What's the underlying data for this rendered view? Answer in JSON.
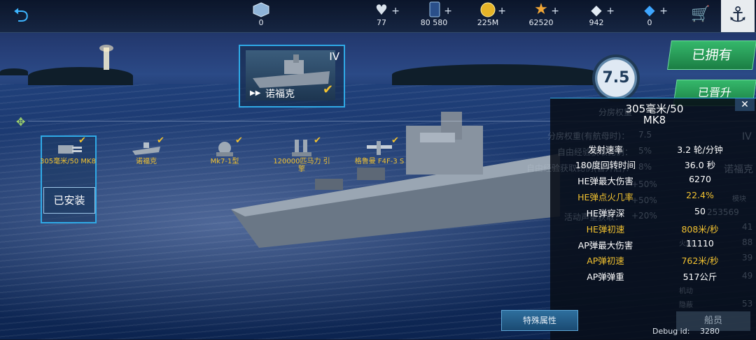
{
  "topbar": {
    "resources": [
      {
        "name": "rank",
        "value": "0",
        "icon": "rank-badge-icon"
      },
      {
        "name": "hearts",
        "value": "77",
        "icon": "heart-icon"
      },
      {
        "name": "cards",
        "value": "80 580",
        "icon": "card-icon"
      },
      {
        "name": "gold",
        "value": "225M",
        "icon": "gold-coin-icon"
      },
      {
        "name": "stars",
        "value": "62520",
        "icon": "star-icon"
      },
      {
        "name": "diamonds",
        "value": "942",
        "icon": "diamond-icon"
      },
      {
        "name": "blue_gems",
        "value": "0",
        "icon": "blue-gem-icon"
      }
    ],
    "plus": "+"
  },
  "ship_card": {
    "tier": "IV",
    "name": "诺福克"
  },
  "rating": "7.5",
  "buttons": {
    "owned": "已拥有",
    "upgraded": "已晋升",
    "installed": "已安装",
    "special": "特殊属性",
    "crew": "船员"
  },
  "modules": [
    {
      "label": "305毫米/50 MK8"
    },
    {
      "label": "诺福克"
    },
    {
      "label": "Mk7-1型"
    },
    {
      "label": "120000匹马力 引擎"
    },
    {
      "label": "格鲁曼 F4F-3 S"
    }
  ],
  "panel": {
    "title": "305毫米/50 MK8",
    "close": "✕",
    "stats": [
      {
        "k": "发射速率",
        "v": "3.2 轮/分钟",
        "hl": false
      },
      {
        "k": "180度回转时间",
        "v": "36.0 秒",
        "hl": false
      },
      {
        "k": "HE弹最大伤害",
        "v": "6270",
        "hl": false
      },
      {
        "k": "HE弹点火几率",
        "v": "22.4%",
        "hl": true
      },
      {
        "k": "HE弹穿深",
        "v": "50",
        "hl": false
      },
      {
        "k": "HE弹初速",
        "v": "808米/秒",
        "hl": true
      },
      {
        "k": "AP弹最大伤害",
        "v": "11110",
        "hl": false
      },
      {
        "k": "AP弹初速",
        "v": "762米/秒",
        "hl": true
      },
      {
        "k": "AP弹弹重",
        "v": "517公斤",
        "hl": false
      }
    ],
    "background_text": {
      "l1": "分房权重",
      "l2": "分房权重(有航母时)：",
      "l3": "自由经验获取比例：",
      "l4": "自由经验获取比例(晋升后)：",
      "v1": "7.5",
      "v2": "5%",
      "v3": "8%",
      "v4": "+50%",
      "v5": "+50%",
      "v6": "+20%",
      "l5": "活动声望获取：",
      "tier": "IV",
      "ship": "诺福克",
      "num": "253569",
      "r1": "41",
      "r2": "88",
      "r3": "39",
      "r4": "49",
      "r5": "53",
      "w1": "火炮",
      "w2": "机动",
      "w3": "隐蔽",
      "w4": "模块"
    }
  },
  "debug": {
    "label": "Debug id:",
    "value": "3280"
  }
}
